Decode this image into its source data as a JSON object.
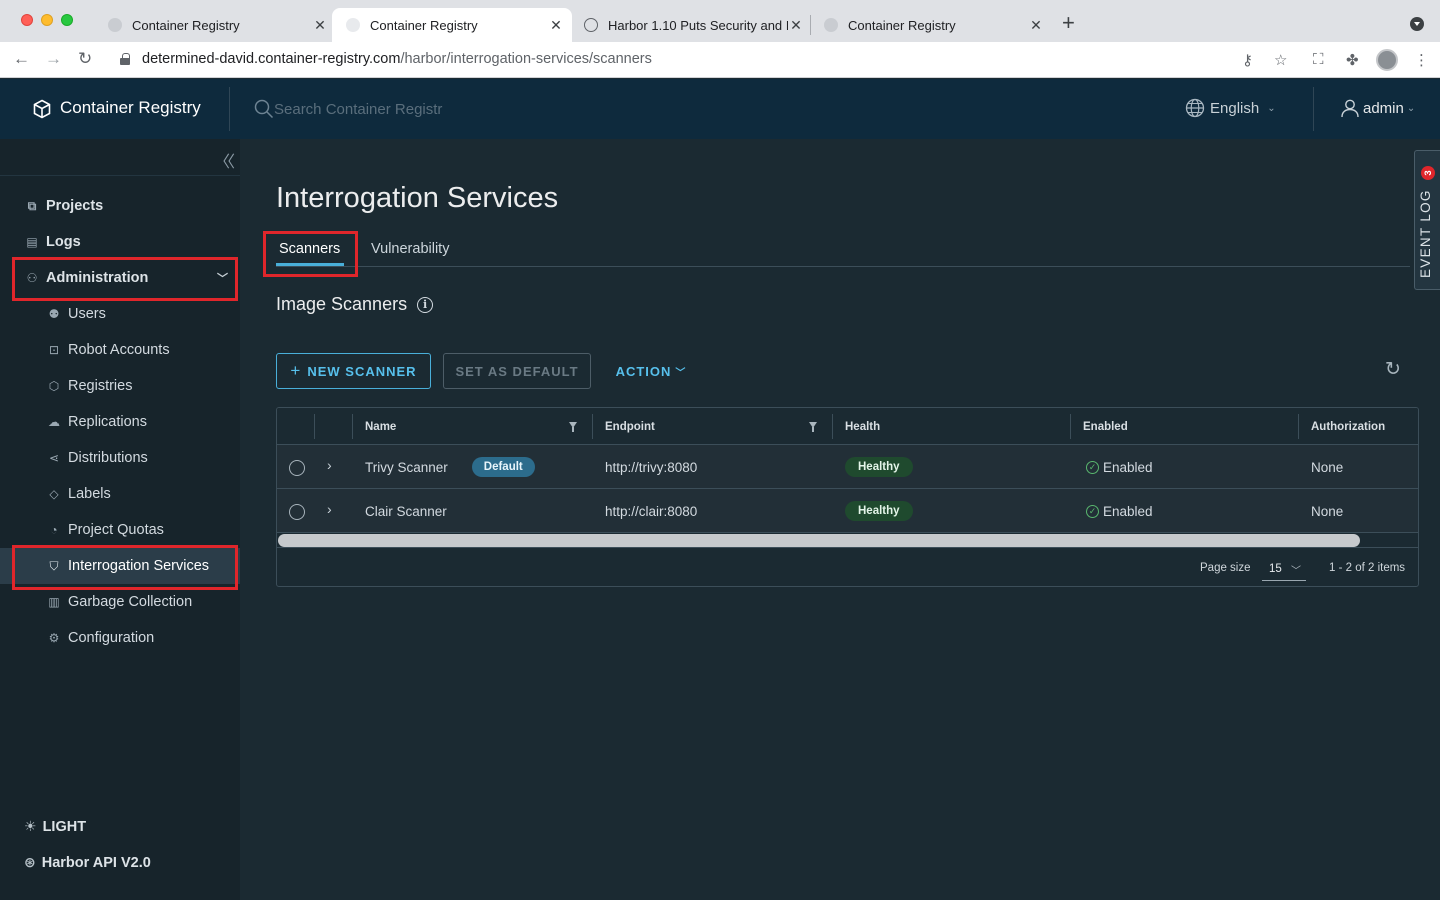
{
  "browser": {
    "tabs": [
      {
        "title": "Container Registry",
        "active": false
      },
      {
        "title": "Container Registry",
        "active": true
      },
      {
        "title": "Harbor 1.10 Puts Security and I",
        "active": false
      },
      {
        "title": "Container Registry",
        "active": false
      }
    ],
    "url_host": "determined-david.container-registry.com",
    "url_path": "/harbor/interrogation-services/scanners"
  },
  "header": {
    "brand": "Container Registry",
    "search_placeholder": "Search Container Registr",
    "language": "English",
    "user": "admin"
  },
  "sidebar": {
    "top_items": [
      {
        "label": "Projects",
        "icon": "projects-icon"
      },
      {
        "label": "Logs",
        "icon": "logs-icon"
      },
      {
        "label": "Administration",
        "icon": "administration-icon",
        "expanded": true
      }
    ],
    "admin_items": [
      {
        "label": "Users",
        "icon": "users-icon"
      },
      {
        "label": "Robot Accounts",
        "icon": "robot-icon"
      },
      {
        "label": "Registries",
        "icon": "registries-icon"
      },
      {
        "label": "Replications",
        "icon": "replications-icon"
      },
      {
        "label": "Distributions",
        "icon": "distributions-icon"
      },
      {
        "label": "Labels",
        "icon": "labels-icon"
      },
      {
        "label": "Project Quotas",
        "icon": "quotas-icon"
      },
      {
        "label": "Interrogation Services",
        "icon": "shield-icon",
        "active": true
      },
      {
        "label": "Garbage Collection",
        "icon": "trash-icon"
      },
      {
        "label": "Configuration",
        "icon": "gear-icon"
      }
    ],
    "theme_toggle": "LIGHT",
    "api_link": "Harbor API V2.0"
  },
  "main": {
    "title": "Interrogation Services",
    "tabs": [
      {
        "label": "Scanners",
        "active": true
      },
      {
        "label": "Vulnerability",
        "active": false
      }
    ],
    "section_title": "Image Scanners",
    "buttons": {
      "new_scanner": "NEW SCANNER",
      "set_default": "SET AS DEFAULT",
      "action": "ACTION"
    },
    "table": {
      "columns": [
        "Name",
        "Endpoint",
        "Health",
        "Enabled",
        "Authorization"
      ],
      "rows": [
        {
          "name": "Trivy Scanner",
          "badge": "Default",
          "endpoint": "http://trivy:8080",
          "health": "Healthy",
          "enabled": "Enabled",
          "authorization": "None"
        },
        {
          "name": "Clair Scanner",
          "badge": "",
          "endpoint": "http://clair:8080",
          "health": "Healthy",
          "enabled": "Enabled",
          "authorization": "None"
        }
      ],
      "page_size_label": "Page size",
      "page_size": "15",
      "item_count": "1 - 2 of 2 items"
    }
  },
  "event_log": {
    "label": "EVENT LOG",
    "count": "3"
  },
  "colors": {
    "header_bg": "#0e2a3d",
    "sidebar_bg": "#17242b",
    "main_bg": "#1b2a32",
    "accent": "#49afd9",
    "highlight_box": "#e0262b",
    "healthy": "#1f4a2e"
  }
}
